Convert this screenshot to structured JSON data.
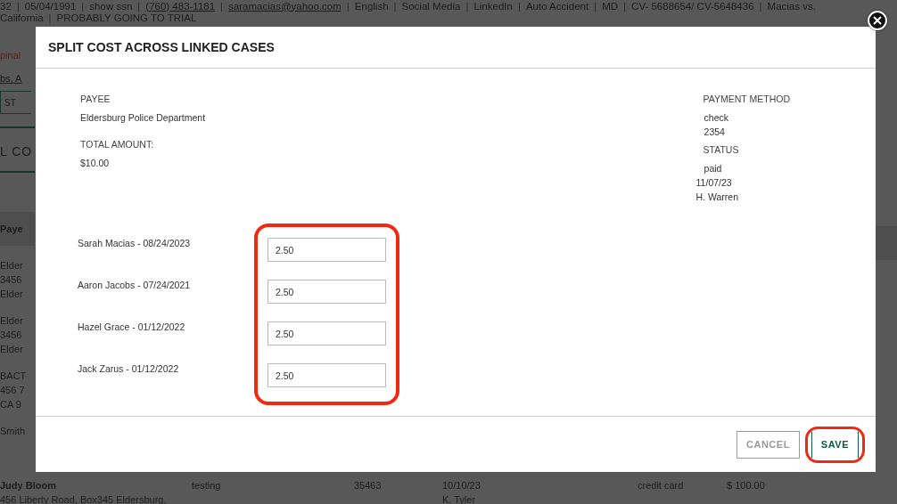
{
  "background": {
    "separator": "|",
    "info_line": [
      {
        "text": "32",
        "kind": "text"
      },
      {
        "text": "05/04/1991",
        "kind": "text"
      },
      {
        "text": "show ssn",
        "kind": "text"
      },
      {
        "text": "(760) 483-1181",
        "kind": "link"
      },
      {
        "text": "saramacias@yahoo.com",
        "kind": "link"
      },
      {
        "text": "English",
        "kind": "text"
      },
      {
        "text": "Social Media",
        "kind": "text"
      },
      {
        "text": "LinkedIn",
        "kind": "text"
      },
      {
        "text": "Auto Accident",
        "kind": "text"
      },
      {
        "text": "MD",
        "kind": "text"
      },
      {
        "text": "CV- 5688654/ CV-5648436",
        "kind": "text"
      },
      {
        "text": "Macias vs.",
        "kind": "text"
      }
    ],
    "info_line_2": [
      "California",
      "PROBABLY GOING TO TRIAL"
    ],
    "alert": "pinal",
    "link": "bs, A",
    "button": "ST",
    "heading": "L CO",
    "table_header": "Paye",
    "left_cells": [
      [
        "Elder",
        "3456",
        "Elder"
      ],
      [
        "Elder",
        "3456",
        "Elder"
      ],
      [
        "BACT",
        "456 7",
        "CA 9"
      ],
      [
        "Smith"
      ]
    ],
    "bottom_row": {
      "cells": [
        "Judy Bloom",
        "testing",
        "35463",
        "10/10/23",
        "credit card",
        "$ 100.00"
      ],
      "second_line": [
        "456 Liberty Road, Box345 Eldersburg,",
        "K. Tyler"
      ]
    }
  },
  "modal": {
    "title": "SPLIT COST ACROSS LINKED CASES",
    "payee_label": "PAYEE",
    "payee": "Eldersburg Police Department",
    "total_label": "TOTAL AMOUNT:",
    "total": "$10.00",
    "payment_method_label": "PAYMENT METHOD",
    "payment_method": "check",
    "check_number": "2354",
    "status_label": "STATUS",
    "status": "paid",
    "status_date": "11/07/23",
    "status_by": "H. Warren",
    "splits_annotated": true,
    "splits": [
      {
        "case": "Sarah Macias - 08/24/2023",
        "amount": "2.50"
      },
      {
        "case": "Aaron Jacobs - 07/24/2021",
        "amount": "2.50"
      },
      {
        "case": "Hazel Grace - 01/12/2022",
        "amount": "2.50"
      },
      {
        "case": "Jack Zarus - 01/12/2022",
        "amount": "2.50"
      }
    ],
    "cancel": "CANCEL",
    "save": "SAVE",
    "save_annotated": true
  }
}
